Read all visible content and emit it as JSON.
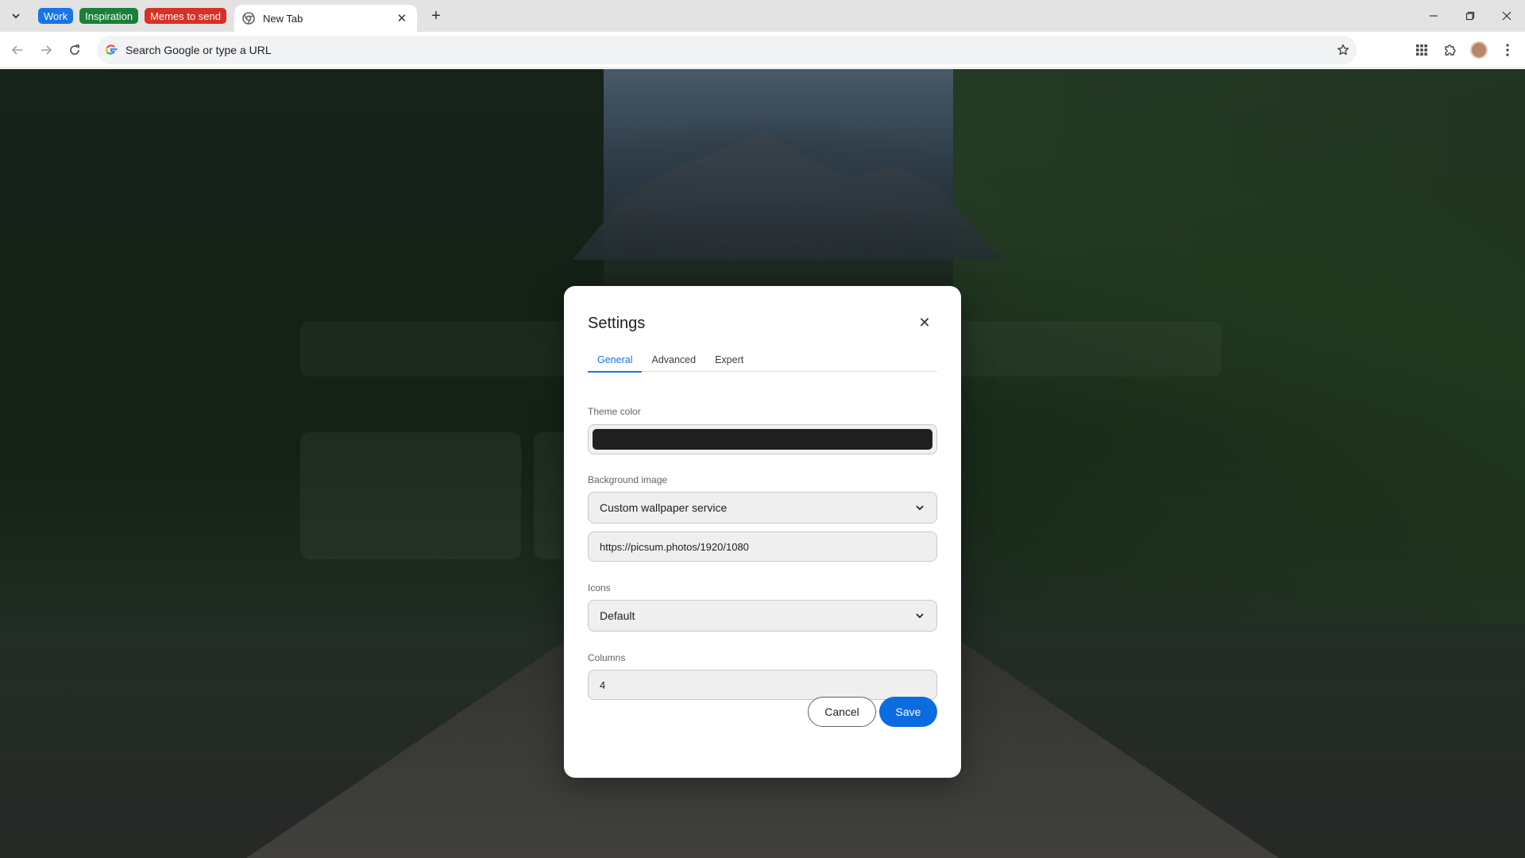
{
  "browser": {
    "tab_groups": [
      {
        "label": "Work",
        "color": "#1a73e8"
      },
      {
        "label": "Inspiration",
        "color": "#188038"
      },
      {
        "label": "Memes to send",
        "color": "#d93025"
      }
    ],
    "active_tab": {
      "title": "New Tab"
    },
    "new_tab_symbol": "+",
    "omnibox": {
      "placeholder": "Search Google or type a URL"
    }
  },
  "dialog": {
    "title": "Settings",
    "tabs": [
      {
        "label": "General",
        "active": true
      },
      {
        "label": "Advanced",
        "active": false
      },
      {
        "label": "Expert",
        "active": false
      }
    ],
    "theme_color": {
      "label": "Theme color",
      "value": "#202020"
    },
    "background_image": {
      "label": "Background image",
      "selected": "Custom wallpaper service",
      "url": "https://picsum.photos/1920/1080"
    },
    "icons": {
      "label": "Icons",
      "selected": "Default"
    },
    "columns": {
      "label": "Columns",
      "value": "4"
    },
    "cancel_label": "Cancel",
    "save_label": "Save"
  },
  "colors": {
    "accent": "#1a73e8",
    "save_button": "#0b6ce0"
  }
}
